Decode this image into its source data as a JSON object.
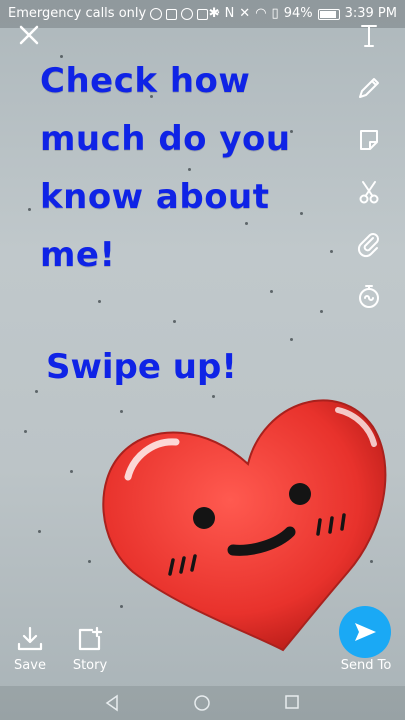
{
  "status_bar": {
    "carrier": "Emergency calls only",
    "battery": "94%",
    "time": "3:39 PM"
  },
  "snap": {
    "message_lines": [
      "Check how",
      "much do you",
      "know about",
      "me!"
    ],
    "swipe": "Swipe up!"
  },
  "tools": [
    "text-icon",
    "pencil-icon",
    "sticker-icon",
    "scissors-icon",
    "paperclip-icon",
    "timer-icon"
  ],
  "bottom": {
    "save_label": "Save",
    "story_label": "Story",
    "send_label": "Send To"
  },
  "colors": {
    "text": "#0f23e6",
    "send": "#1aa9f5",
    "heart": "#e8322c"
  }
}
